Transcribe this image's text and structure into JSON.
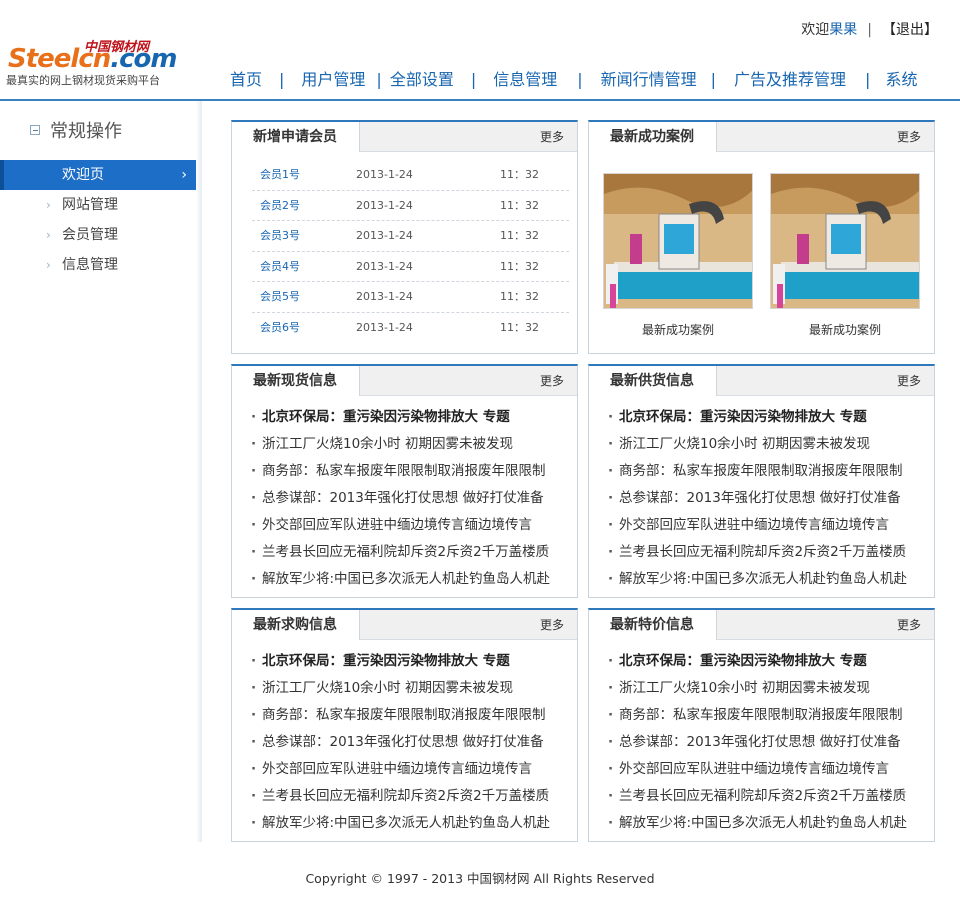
{
  "header": {
    "logo_cn": "中国钢材网",
    "logo_main_part1": "Steelcn",
    "logo_main_part2": ".com",
    "slogan": "最真实的网上钢材现货采购平台",
    "welcome": "欢迎",
    "username": "果果",
    "separator": "|",
    "logout": "【退出】"
  },
  "nav": {
    "items": [
      "首页",
      "用户管理",
      "全部设置",
      "信息管理",
      "新闻行情管理",
      "广告及推荐管理",
      "系统"
    ],
    "separator": "|"
  },
  "sidebar": {
    "title": "常规操作",
    "items": [
      {
        "label": "欢迎页",
        "active": true
      },
      {
        "label": "网站管理",
        "active": false
      },
      {
        "label": "会员管理",
        "active": false
      },
      {
        "label": "信息管理",
        "active": false
      }
    ]
  },
  "panels": {
    "more_label": "更多",
    "members": {
      "title": "新增申请会员",
      "rows": [
        {
          "name": "会员1号",
          "date": "2013-1-24",
          "time": "11：32"
        },
        {
          "name": "会员2号",
          "date": "2013-1-24",
          "time": "11：32"
        },
        {
          "name": "会员3号",
          "date": "2013-1-24",
          "time": "11：32"
        },
        {
          "name": "会员4号",
          "date": "2013-1-24",
          "time": "11：32"
        },
        {
          "name": "会员5号",
          "date": "2013-1-24",
          "time": "11：32"
        },
        {
          "name": "会员6号",
          "date": "2013-1-24",
          "time": "11：32"
        }
      ]
    },
    "cases": {
      "title": "最新成功案例",
      "items": [
        {
          "label": "最新成功案例"
        },
        {
          "label": "最新成功案例"
        }
      ]
    },
    "spot": {
      "title": "最新现货信息"
    },
    "supply": {
      "title": "最新供货信息"
    },
    "purchase": {
      "title": "最新求购信息"
    },
    "special": {
      "title": "最新特价信息"
    },
    "news_items": [
      "北京环保局：重污染因污染物排放大 专题",
      "浙江工厂火烧10余小时 初期因雾未被发现",
      "商务部：私家车报废年限限制取消报废年限限制",
      "总参谋部：2013年强化打仗思想 做好打仗准备",
      "外交部回应军队进驻中缅边境传言缅边境传言",
      "兰考县长回应无福利院却斥资2斥资2千万盖楼质",
      "解放军少将:中国已多次派无人机赴钓鱼岛人机赴"
    ]
  },
  "footer": {
    "text": "Copyright © 1997 - 2013  中国钢材网 All Rights Reserved"
  },
  "colors": {
    "brand_blue": "#1866b0",
    "brand_orange": "#e8701a",
    "active_blue": "#1d6ec6"
  }
}
